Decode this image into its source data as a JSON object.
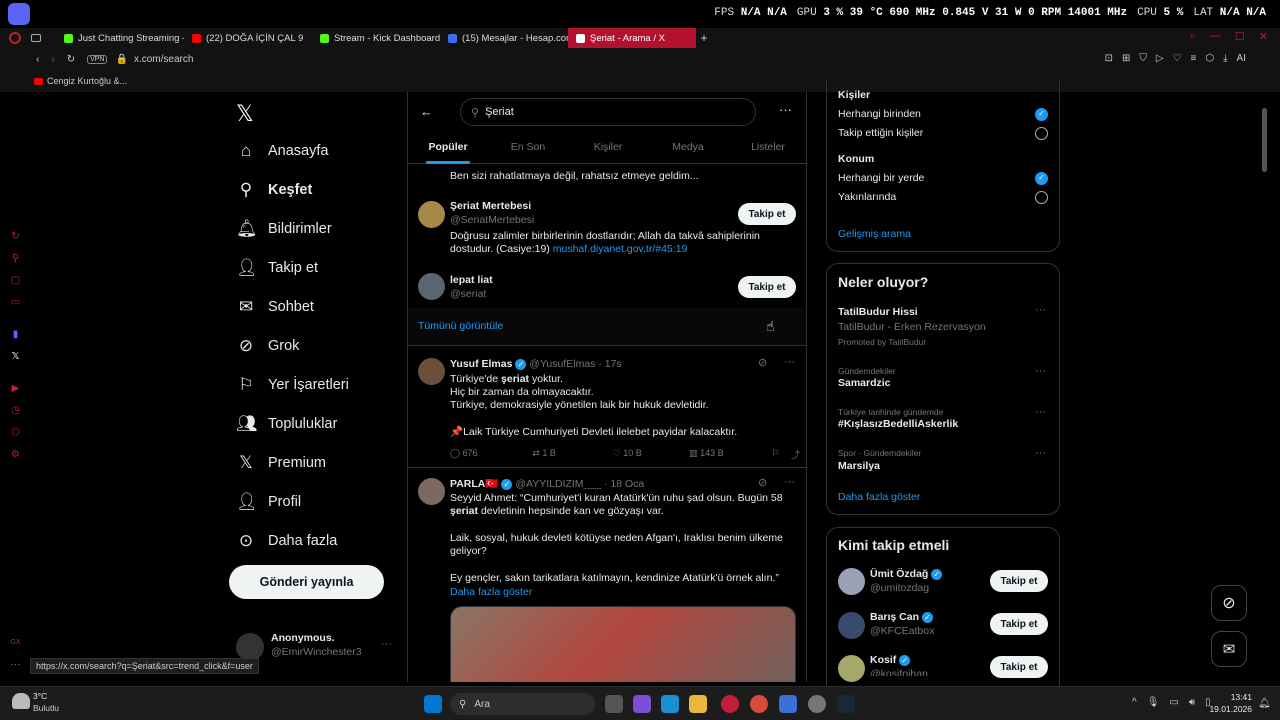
{
  "osd": {
    "fps_label": "FPS",
    "fps_v1": "N/A",
    "fps_v2": "N/A",
    "gpu_label": "GPU",
    "gpu_load": "3 %",
    "gpu_temp": "39 °C",
    "gpu_clock": "690 MHz",
    "gpu_volt": "0.845 V",
    "gpu_power": "31 W",
    "gpu_rpm": "0 RPM",
    "gpu_mem": "14001 MHz",
    "cpu_label": "CPU",
    "cpu_load": "5 %",
    "lat_label": "LAT",
    "lat_v1": "N/A",
    "lat_v2": "N/A"
  },
  "tabs": [
    {
      "label": "Just Chatting Streaming -",
      "color": "#53fc18"
    },
    {
      "label": "(22) DOĞA İÇİN ÇAL 9",
      "color": "#ff0000"
    },
    {
      "label": "Stream - Kick Dashboard",
      "color": "#53fc18"
    },
    {
      "label": "(15) Mesajlar - Hesap.com",
      "color": "#3b6cf5"
    },
    {
      "label": "Şeriat - Arama / X",
      "color": "#ffffff"
    }
  ],
  "address": {
    "url": "x.com/search",
    "vpn": "VPN",
    "ai": "AI"
  },
  "bookmark": {
    "label": "Cengiz Kurtoğlu &..."
  },
  "nav": {
    "items": [
      "Anasayfa",
      "Keşfet",
      "Bildirimler",
      "Takip et",
      "Sohbet",
      "Grok",
      "Yer İşaretleri",
      "Topluluklar",
      "Premium",
      "Profil",
      "Daha fazla"
    ],
    "post_button": "Gönderi yayınla",
    "account_name": "Anonymous.",
    "account_handle": "@EmirWinchester3"
  },
  "search": {
    "query": "Şeriat"
  },
  "center_tabs": [
    "Popüler",
    "En Son",
    "Kişiler",
    "Medya",
    "Listeler"
  ],
  "people": {
    "top_bio": "Ben sizi rahatlatmaya değil, rahatsız etmeye geldim...",
    "p1": {
      "name": "Şeriat Mertebesi",
      "handle": "@SeriatMertebesi",
      "bio": "Doğrusu zalimler birbirlerinin dostlarıdır; Allah da takvâ sahiplerinin dostudur. (Casiye:19)",
      "link": "mushaf.diyanet.gov.tr/#45:19"
    },
    "p2": {
      "name": "lepat liat",
      "handle": "@seriat"
    },
    "follow": "Takip et",
    "show_all": "Tümünü görüntüle"
  },
  "tweet1": {
    "name": "Yusuf Elmas",
    "handle": "@YusufElmas · 17s",
    "l1a": "Türkiye'de ",
    "l1b": "şeriat",
    "l1c": " yoktur.",
    "l2": "Hiç bir zaman da olmayacaktır.",
    "l3": "Türkiye, demokrasiyle yönetilen laik bir hukuk devletidir.",
    "l4": "📌Laik Türkiye Cumhuriyeti Devleti ilelebet payidar kalacaktır.",
    "replies": "676",
    "retweets": "1 B",
    "likes": "10 B",
    "views": "143 B"
  },
  "tweet2": {
    "name": "PARLA🇹🇷",
    "handle": "@AYYILDIZIM___ · 18 Oca",
    "l1": "Seyyid Ahmet: “Cumhuriyet'i kuran Atatürk'ün ruhu şad olsun. Bugün 58",
    "l2a": "şeriat",
    "l2b": " devletinin hepsinde kan ve gözyaşı var.",
    "l3": "Laik, sosyal, hukuk devleti kötüyse neden Afgan'ı, Iraklısı benim ülkeme",
    "l4": "geliyor?",
    "l5": "Ey gençler, sakın tarikatlara katılmayın, kendinize Atatürk'ü örnek alın.”",
    "more": "Daha fazla göster"
  },
  "filters": {
    "people_title": "Kişiler",
    "people_opt1": "Herhangi birinden",
    "people_opt2": "Takip ettiğin kişiler",
    "loc_title": "Konum",
    "loc_opt1": "Herhangi bir yerde",
    "loc_opt2": "Yakınlarında",
    "advanced": "Gelişmiş arama"
  },
  "trends": {
    "title": "Neler oluyor?",
    "promo_name": "TatilBudur Hissi",
    "promo_desc": "TatilBudur - Erken Rezervasyon",
    "promo_by": "Promoted by TatilBudur",
    "t1_cat": "Gündemdekiler",
    "t1_name": "Samardzic",
    "t2_cat": "Türkiye tarihinde gündemde",
    "t2_name": "#KışlasızBedelliAskerlik",
    "t3_cat": "Spor · Gündemdekiler",
    "t3_name": "Marsilya",
    "more": "Daha fazla göster"
  },
  "who": {
    "title": "Kimi takip etmeli",
    "u1_name": "Ümit Özdağ",
    "u1_handle": "@umitozdag",
    "u2_name": "Barış Can",
    "u2_handle": "@KFCEatbox",
    "u3_name": "Kosif",
    "u3_handle": "@kosifoihan",
    "follow": "Takip et"
  },
  "statusbar": {
    "url": "https://x.com/search?q=Şeriat&src=trend_click&f=user"
  },
  "taskbar": {
    "temp": "3°C",
    "weather": "Bulutlu",
    "search": "Ara",
    "time": "13:41",
    "date": "19.01.2026"
  }
}
